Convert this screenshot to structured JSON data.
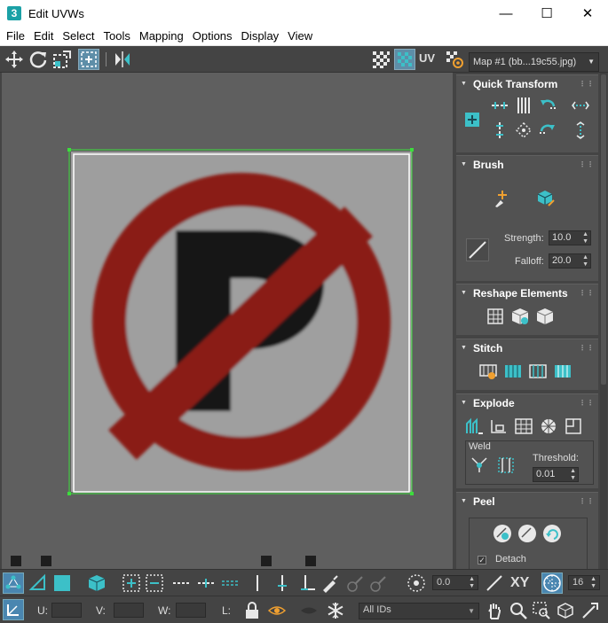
{
  "window": {
    "icon_label": "3",
    "title": "Edit UVWs",
    "minimize": "—",
    "maximize": "☐",
    "close": "✕"
  },
  "menu": [
    "File",
    "Edit",
    "Select",
    "Tools",
    "Mapping",
    "Options",
    "Display",
    "View"
  ],
  "toolbar": {
    "uv_label": "UV",
    "map_select": "Map #1 (bb...19c55.jpg)",
    "dropdown_arrow": "▼"
  },
  "panel": {
    "quick_transform": {
      "title": "Quick Transform"
    },
    "brush": {
      "title": "Brush",
      "strength_label": "Strength:",
      "strength_value": "10.0",
      "falloff_label": "Falloff:",
      "falloff_value": "20.0"
    },
    "reshape": {
      "title": "Reshape Elements"
    },
    "stitch": {
      "title": "Stitch"
    },
    "explode": {
      "title": "Explode",
      "weld_label": "Weld",
      "threshold_label": "Threshold:",
      "threshold_value": "0.01"
    },
    "peel": {
      "title": "Peel",
      "detach_label": "Detach",
      "detach_checked": true
    },
    "collapse_glyph": "▼",
    "grip_glyph": "⋮⋮",
    "spin_glyph": "▲▼"
  },
  "bottom": {
    "angle_value": "0.0",
    "xy_label": "XY",
    "grid_value": "16",
    "u_label": "U:",
    "v_label": "V:",
    "w_label": "W:",
    "l_label": "L:",
    "id_filter": "All IDs"
  },
  "colors": {
    "accent_teal": "#3cc0c8",
    "sign_red": "#8a1c14",
    "selection_green": "#3ddc3d",
    "viewport_bg": "#5f5f5f"
  }
}
